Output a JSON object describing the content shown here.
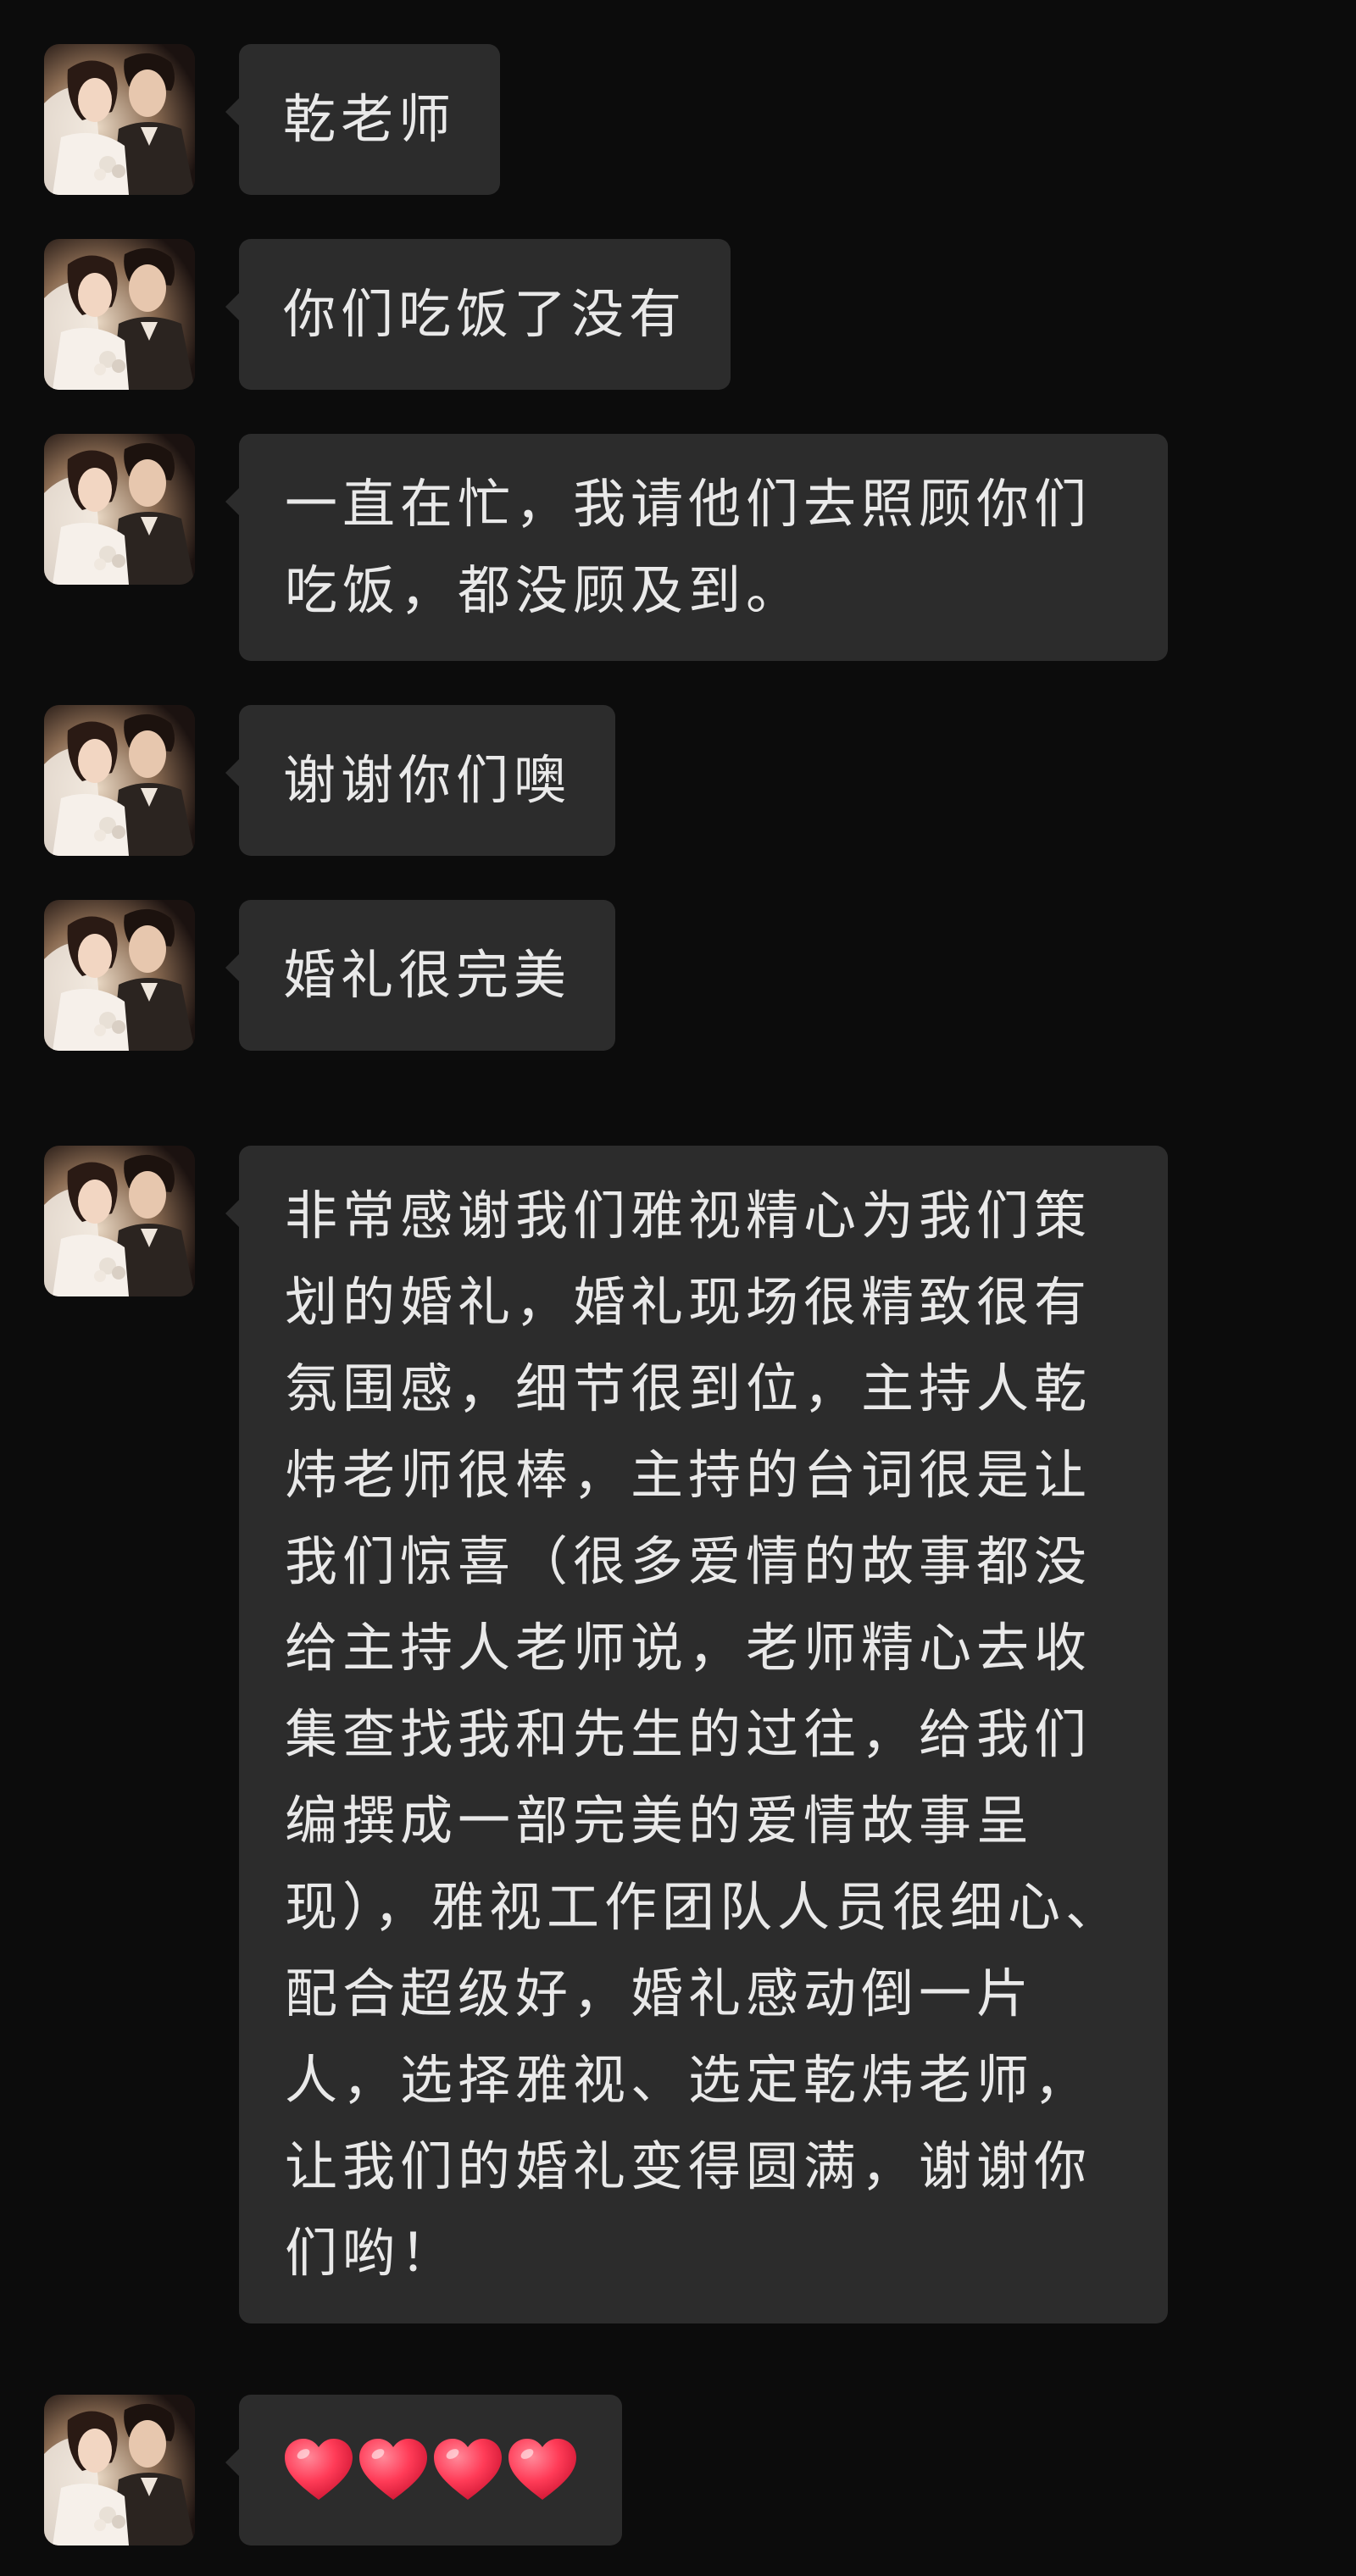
{
  "messages": [
    {
      "text": "乾老师"
    },
    {
      "text": "你们吃饭了没有"
    },
    {
      "text": "一直在忙，我请他们去照顾你们吃饭，都没顾及到。"
    },
    {
      "text": "谢谢你们噢"
    },
    {
      "text": "婚礼很完美"
    },
    {
      "text": "非常感谢我们雅视精心为我们策划的婚礼，婚礼现场很精致很有氛围感，细节很到位，主持人乾炜老师很棒，主持的台词很是让我们惊喜（很多爱情的故事都没给主持人老师说，老师精心去收集查找我和先生的过往，给我们编撰成一部完美的爱情故事呈现），雅视工作团队人员很细心、配合超级好，婚礼感动倒一片人，选择雅视、选定乾炜老师，让我们的婚礼变得圆满，谢谢你们哟！"
    },
    {
      "emoji": [
        "heart-emoji",
        "heart-emoji",
        "heart-emoji",
        "heart-emoji"
      ]
    }
  ],
  "colors": {
    "background": "#0c0c0c",
    "bubble": "#2c2c2c",
    "text": "#e9e9e9",
    "heart": "#ff3b57"
  }
}
